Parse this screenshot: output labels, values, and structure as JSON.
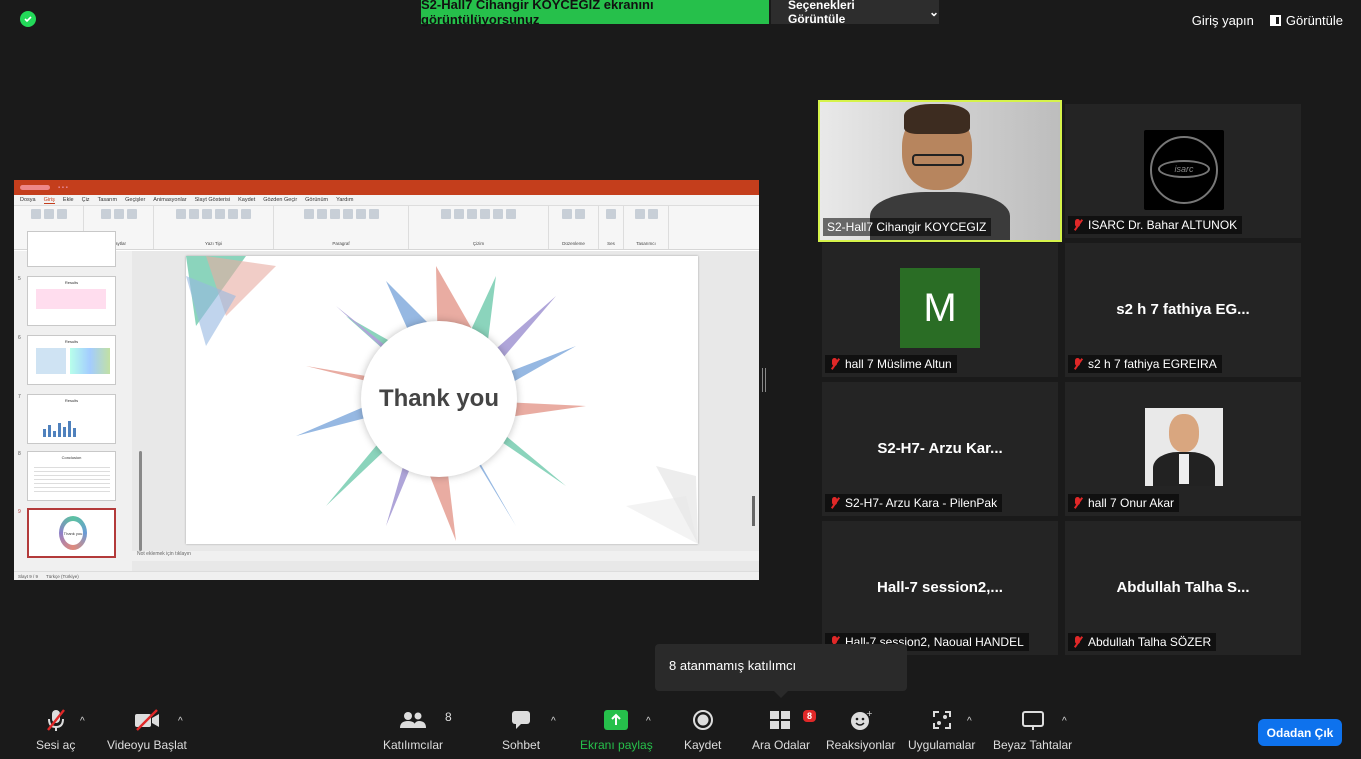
{
  "top": {
    "share_banner": "S2-Hall7 Cihangir KOYCEGIZ ekranını görüntülüyorsunuz",
    "view_options": "Seçenekleri Görüntüle",
    "sign_in": "Giriş yapın",
    "view": "Görüntüle"
  },
  "ppt": {
    "menu": [
      "Dosya",
      "Giriş",
      "Ekle",
      "Çiz",
      "Tasarım",
      "Geçişler",
      "Animasyonlar",
      "Slayt Gösterisi",
      "Kaydet",
      "Gözden Geçir",
      "Görünüm",
      "Yardım"
    ],
    "ribbon_groups": [
      "Pano",
      "Slaytlar",
      "Yazı Tipi",
      "Paragraf",
      "Çizim",
      "Düzenleme",
      "Ses",
      "Tasarımcı"
    ],
    "thumb_titles": [
      "Results",
      "Results",
      "Results",
      "Conclusion",
      "Thank you"
    ],
    "thumb_numbers": [
      "5",
      "6",
      "7",
      "8",
      "9"
    ],
    "slide_text": "Thank you",
    "notes": "Not eklemek için tıklayın",
    "status": "Slayt 9 / 9",
    "language": "Türkçe (Türkiye)"
  },
  "participants": [
    {
      "name": "S2-Hall7 Cihangir KOYCEGIZ",
      "display": "",
      "muted": false
    },
    {
      "name": "ISARC Dr. Bahar ALTUNOK",
      "display": "",
      "muted": true
    },
    {
      "name": "hall 7 Müslime Altun",
      "display": "",
      "avatar": "M",
      "muted": true
    },
    {
      "name": "s2 h 7 fathiya EGREIRA",
      "display": "s2 h 7 fathiya EG...",
      "muted": true
    },
    {
      "name": "S2-H7- Arzu Kara - PilenPak",
      "display": "S2-H7- Arzu Kar...",
      "muted": true
    },
    {
      "name": "hall 7 Onur Akar",
      "display": "",
      "muted": true
    },
    {
      "name": "Hall-7 session2, Naoual HANDEL",
      "display": "Hall-7 session2,...",
      "muted": true
    },
    {
      "name": "Abdullah Talha SÖZER",
      "display": "Abdullah Talha S...",
      "muted": true
    }
  ],
  "tooltip": "8 atanmamış katılımcı",
  "toolbar": {
    "unmute": "Sesi aç",
    "start_video": "Videoyu Başlat",
    "participants": "Katılımcılar",
    "participants_count": "8",
    "chat": "Sohbet",
    "share_screen": "Ekranı paylaş",
    "record": "Kaydet",
    "breakout": "Ara Odalar",
    "breakout_count": "8",
    "reactions": "Reaksiyonlar",
    "apps": "Uygulamalar",
    "whiteboard": "Beyaz Tahtalar",
    "leave": "Odadan Çık"
  },
  "colors": {
    "share_green": "#26c04b",
    "active_speaker": "#d6f34a",
    "leave_blue": "#0e72ed",
    "ppt_red": "#c43e1c",
    "muted_red": "#e02828"
  }
}
